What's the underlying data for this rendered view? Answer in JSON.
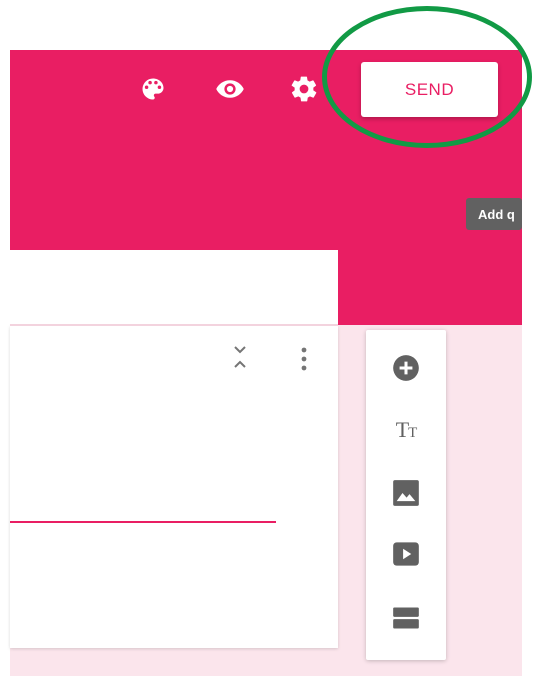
{
  "header": {
    "icons": [
      "palette-icon",
      "eye-icon",
      "gear-icon"
    ],
    "send_label": "SEND",
    "color": "#e91e63"
  },
  "tooltip": {
    "text": "Add q"
  },
  "sidebar": {
    "buttons": [
      {
        "name": "add-question",
        "icon": "add-circle-icon"
      },
      {
        "name": "add-title",
        "icon": "title-icon",
        "glyph_big": "T",
        "glyph_small": "T"
      },
      {
        "name": "add-image",
        "icon": "image-icon"
      },
      {
        "name": "add-video",
        "icon": "video-icon"
      },
      {
        "name": "add-section",
        "icon": "section-icon"
      }
    ]
  },
  "colors": {
    "accent": "#e91e63",
    "highlight_circle": "#119a45",
    "icon_gray": "#616161"
  }
}
